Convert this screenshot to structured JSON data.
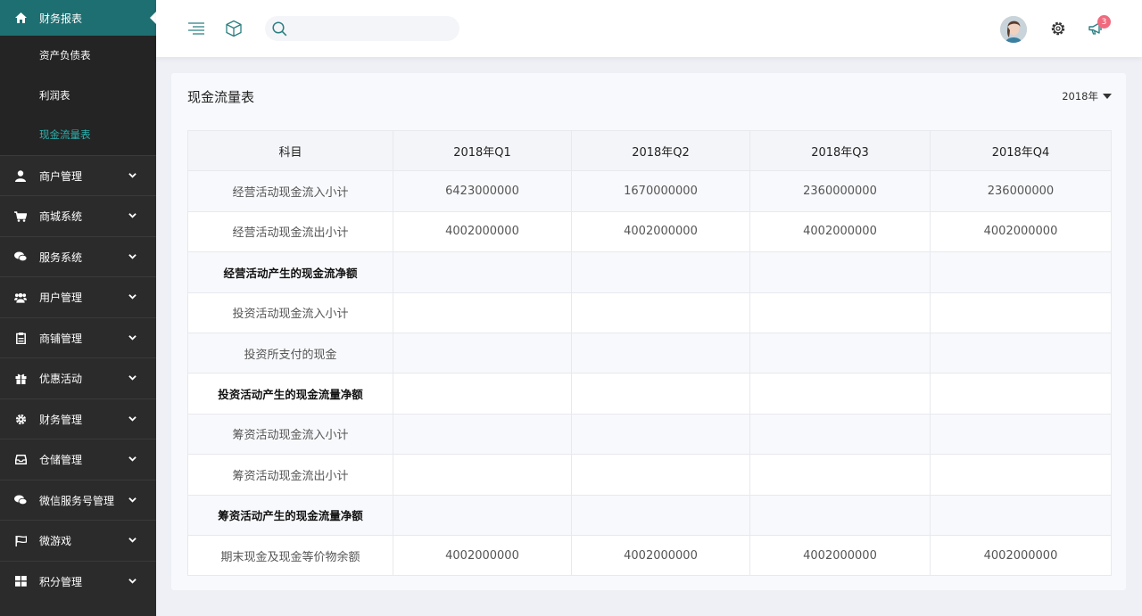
{
  "sidebar": {
    "active": {
      "label": "财务报表",
      "icon": "home-icon"
    },
    "sub_items": [
      {
        "label": "资产负债表",
        "current": false
      },
      {
        "label": "利润表",
        "current": false
      },
      {
        "label": "现金流量表",
        "current": true
      }
    ],
    "items": [
      {
        "label": "商户管理",
        "icon": "user-icon"
      },
      {
        "label": "商城系统",
        "icon": "cart-icon"
      },
      {
        "label": "服务系统",
        "icon": "chat-icon"
      },
      {
        "label": "用户管理",
        "icon": "users-icon"
      },
      {
        "label": "商铺管理",
        "icon": "clipboard-icon"
      },
      {
        "label": "优惠活动",
        "icon": "gift-icon"
      },
      {
        "label": "财务管理",
        "icon": "gear-icon"
      },
      {
        "label": "仓储管理",
        "icon": "inbox-icon"
      },
      {
        "label": "微信服务号管理",
        "icon": "wechat-icon"
      },
      {
        "label": "微游戏",
        "icon": "flag-icon"
      },
      {
        "label": "积分管理",
        "icon": "grid-icon"
      }
    ]
  },
  "header": {
    "search_placeholder": "",
    "notification_count": "3",
    "colors": {
      "accent": "#1e6f72",
      "badge": "#f06a7e"
    }
  },
  "card": {
    "title": "现金流量表",
    "year": "2018年",
    "columns": [
      "科目",
      "2018年Q1",
      "2018年Q2",
      "2018年Q3",
      "2018年Q4"
    ],
    "rows": [
      {
        "label": "经营活动现金流入小计",
        "bold": false,
        "values": [
          "6423000000",
          "1670000000",
          "2360000000",
          "236000000"
        ]
      },
      {
        "label": "经营活动现金流出小计",
        "bold": false,
        "values": [
          "4002000000",
          "4002000000",
          "4002000000",
          "4002000000"
        ]
      },
      {
        "label": "经营活动产生的现金流净额",
        "bold": true,
        "values": [
          "",
          "",
          "",
          ""
        ]
      },
      {
        "label": "投资活动现金流入小计",
        "bold": false,
        "values": [
          "",
          "",
          "",
          ""
        ]
      },
      {
        "label": "投资所支付的现金",
        "bold": false,
        "values": [
          "",
          "",
          "",
          ""
        ]
      },
      {
        "label": "投资活动产生的现金流量净额",
        "bold": true,
        "values": [
          "",
          "",
          "",
          ""
        ]
      },
      {
        "label": "筹资活动现金流入小计",
        "bold": false,
        "values": [
          "",
          "",
          "",
          ""
        ]
      },
      {
        "label": "筹资活动现金流出小计",
        "bold": false,
        "values": [
          "",
          "",
          "",
          ""
        ]
      },
      {
        "label": "筹资活动产生的现金流量净额",
        "bold": true,
        "values": [
          "",
          "",
          "",
          ""
        ]
      },
      {
        "label": "期末现金及现金等价物余额",
        "bold": false,
        "values": [
          "4002000000",
          "4002000000",
          "4002000000",
          "4002000000"
        ]
      }
    ]
  }
}
